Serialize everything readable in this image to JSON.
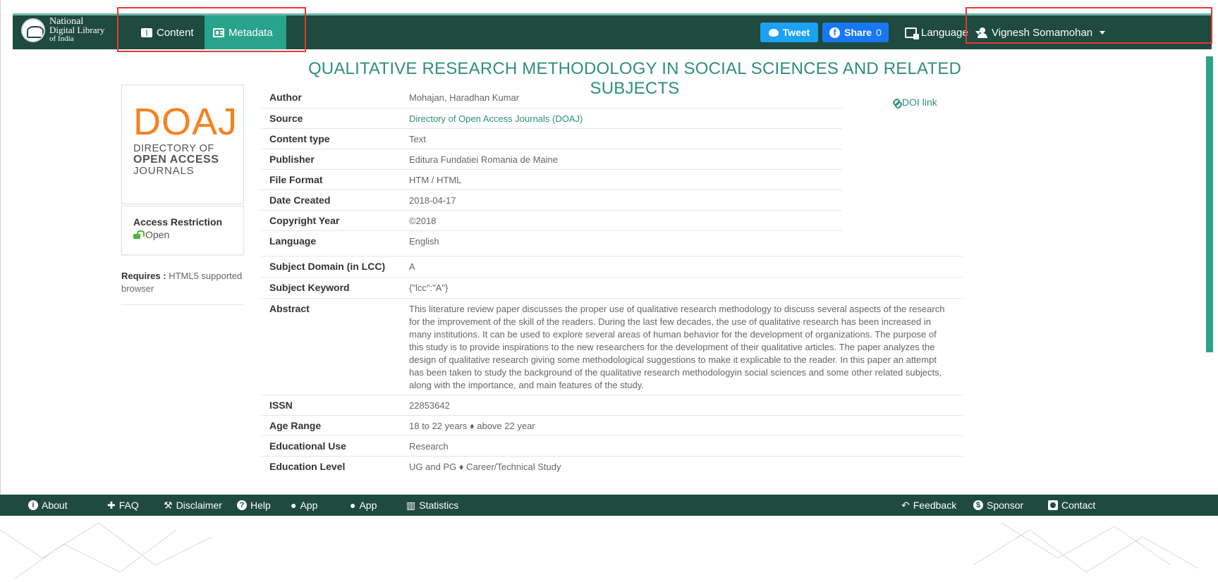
{
  "brand": {
    "line1": "National",
    "line2": "Digital Library",
    "line3": "of India"
  },
  "nav": {
    "content_label": "Content",
    "metadata_label": "Metadata",
    "tweet_label": "Tweet",
    "share_label": "Share",
    "share_count": "0",
    "language_label": "Language",
    "user_label": "Vignesh Somamohan"
  },
  "document": {
    "title": "QUALITATIVE RESEARCH METHODOLOGY IN SOCIAL SCIENCES AND RELATED SUBJECTS",
    "doi_label": "DOI link",
    "cover": {
      "big": "DOAJ",
      "line1": "DIRECTORY OF",
      "line2": "OPEN ACCESS",
      "line3": "JOURNALS"
    },
    "access": {
      "title": "Access Restriction",
      "value": "Open"
    },
    "requires": {
      "label": "Requires :",
      "value": "HTML5 supported browser"
    }
  },
  "metadata": [
    {
      "key": "Author",
      "value": "Mohajan, Haradhan Kumar"
    },
    {
      "key": "Source",
      "value": "Directory of Open Access Journals (DOAJ)"
    },
    {
      "key": "Content type",
      "value": "Text"
    },
    {
      "key": "Publisher",
      "value": "Editura Fundatiei Romania de Maine"
    },
    {
      "key": "File Format",
      "value": "HTM / HTML"
    },
    {
      "key": "Date Created",
      "value": "2018-04-17"
    },
    {
      "key": "Copyright Year",
      "value": "©2018"
    },
    {
      "key": "Language",
      "value": "English"
    },
    {
      "key": "Subject Domain (in LCC)",
      "value": "A"
    },
    {
      "key": "Subject Keyword",
      "value": "{\"lcc\":\"A\"}"
    },
    {
      "key": "Abstract",
      "value": "This literature review paper discusses the proper use of qualitative research methodology to discuss several aspects of the research for the improvement of the skill of the readers. During the last few decades, the use of qualitative research has been increased in many institutions. It can be used to explore several areas of human behavior for the development of organizations. The purpose of this study is to provide inspirations to the new researchers for the development of their qualitative articles. The paper analyzes the design of qualitative research giving some methodological suggestions to make it explicable to the reader. In this paper an attempt has been taken to study the background of the qualitative research methodologyin social sciences and some other related subjects, along with the importance, and main features of the study."
    },
    {
      "key": "ISSN",
      "value": "22853642"
    },
    {
      "key": "Age Range",
      "value": "18 to 22 years ♦ above 22 year"
    },
    {
      "key": "Educational Use",
      "value": "Research"
    },
    {
      "key": "Education Level",
      "value": "UG and PG ♦ Career/Technical Study"
    }
  ],
  "footer": {
    "about": "About",
    "faq": "FAQ",
    "disclaimer": "Disclaimer",
    "help": "Help",
    "app_android": "App",
    "app_ios": "App",
    "statistics": "Statistics",
    "feedback": "Feedback",
    "sponsor": "Sponsor",
    "contact": "Contact"
  },
  "colors": {
    "navbar": "#1e4a3f",
    "accent": "#2aa38c",
    "title": "#2e8f7c",
    "doaj_orange": "#f58220",
    "highlight_box": "#e53935",
    "tweet": "#1da1f2",
    "facebook": "#1877f2"
  },
  "icons": [
    "book-icon",
    "metadata-icon",
    "twitter-icon",
    "facebook-icon",
    "language-icon",
    "user-icon",
    "link-icon",
    "unlock-icon",
    "info-icon",
    "faq-icon",
    "gavel-icon",
    "question-icon",
    "android-icon",
    "apple-icon",
    "bar-chart-icon",
    "feedback-icon",
    "sponsor-icon",
    "contact-icon"
  ]
}
